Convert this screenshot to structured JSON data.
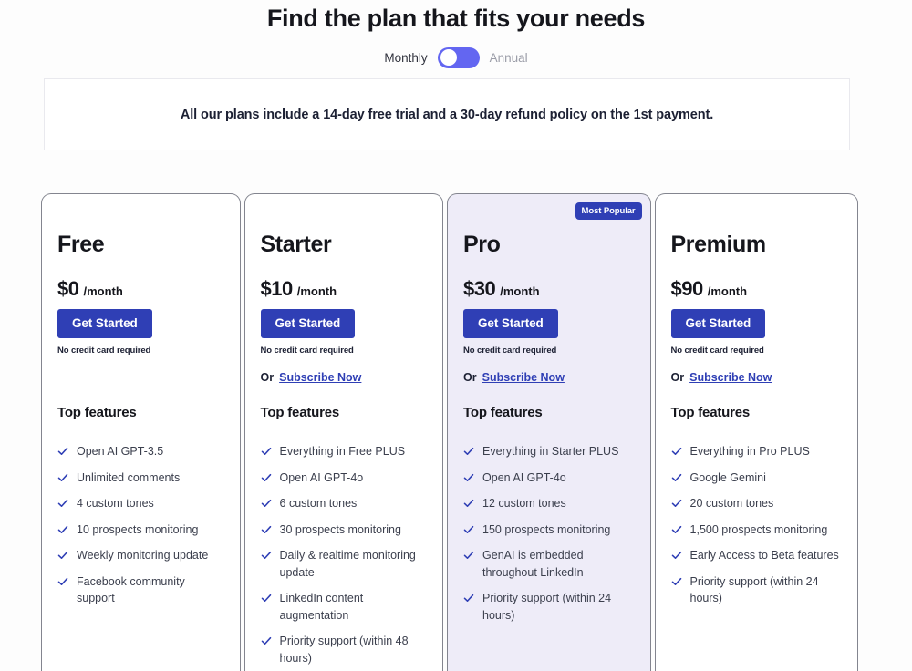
{
  "header": {
    "title": "Find the plan that fits your needs"
  },
  "billing": {
    "monthly_label": "Monthly",
    "annual_label": "Annual",
    "selected": "Monthly",
    "toggle_state": "off",
    "accent_color": "#6366f1"
  },
  "notice": {
    "text": "All our plans include a 14-day free trial and a 30-day refund policy on the 1st payment."
  },
  "common": {
    "cta_label": "Get Started",
    "fineprint": "No credit card required",
    "or_word": "Or",
    "subscribe_label": "Subscribe Now",
    "features_heading": "Top features",
    "badge_label": "Most Popular",
    "brand_color": "#2f3fb5",
    "featured_bg": "#eeecf8",
    "check_icon": "check-icon"
  },
  "plans": [
    {
      "name": "Free",
      "price": "$0",
      "period": "/month",
      "has_subscribe": false,
      "featured": false,
      "badge": null,
      "features": [
        "Open AI GPT-3.5",
        "Unlimited comments",
        "4 custom tones",
        "10 prospects monitoring",
        "Weekly monitoring update",
        "Facebook community support"
      ]
    },
    {
      "name": "Starter",
      "price": "$10",
      "period": "/month",
      "has_subscribe": true,
      "featured": false,
      "badge": null,
      "features": [
        "Everything in Free PLUS",
        "Open AI GPT-4o",
        "6 custom tones",
        "30 prospects monitoring",
        "Daily & realtime monitoring update",
        "LinkedIn content augmentation",
        "Priority support (within 48 hours)"
      ]
    },
    {
      "name": "Pro",
      "price": "$30",
      "period": "/month",
      "has_subscribe": true,
      "featured": true,
      "badge": "Most Popular",
      "features": [
        "Everything in Starter PLUS",
        "Open AI GPT-4o",
        "12 custom tones",
        "150 prospects monitoring",
        "GenAI is embedded throughout LinkedIn",
        "Priority support (within 24 hours)"
      ]
    },
    {
      "name": "Premium",
      "price": "$90",
      "period": "/month",
      "has_subscribe": true,
      "featured": false,
      "badge": null,
      "features": [
        "Everything in Pro PLUS",
        "Google Gemini",
        "20 custom tones",
        "1,500 prospects monitoring",
        "Early Access to Beta features",
        "Priority support (within 24 hours)"
      ]
    }
  ]
}
